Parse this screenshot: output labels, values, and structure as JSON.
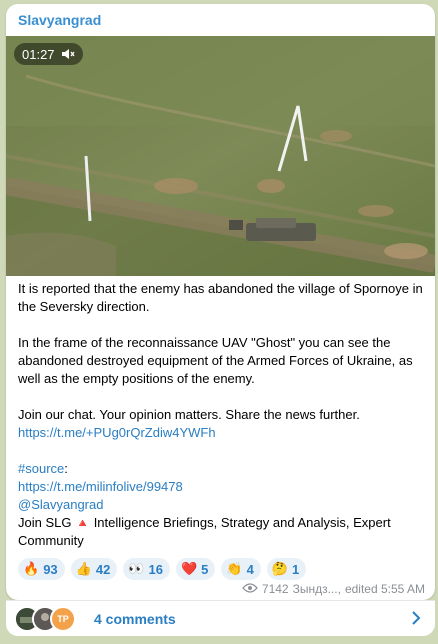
{
  "post": {
    "channel_name": "Slavyangrad",
    "video": {
      "duration": "01:27",
      "muted_icon": "speaker-muted-icon"
    },
    "paragraph1": "It is reported that the enemy has abandoned the village of Spornoye in the Seversky direction.",
    "paragraph2": "In the frame of the reconnaissance UAV \"Ghost\" you can see the abandoned destroyed equipment of the Armed Forces of Ukraine, as well as the empty positions of the enemy.",
    "paragraph3": "Join our chat. Your opinion matters. Share the news further.",
    "chat_link": "https://t.me/+PUg0rQrZdiw4YWFh",
    "hashtag": "#source",
    "hashtag_colon": ":",
    "source_link": "https://t.me/milinfolive/99478",
    "mention": "@Slavyangrad",
    "join_prefix": "Join SLG",
    "join_flag": "🔺",
    "join_suffix": "Intelligence Briefings, Strategy and Analysis, Expert Community"
  },
  "reactions": [
    {
      "emoji": "🔥",
      "icon": "fire-icon",
      "count": "93"
    },
    {
      "emoji": "👍",
      "icon": "thumbs-up-icon",
      "count": "42"
    },
    {
      "emoji": "👀",
      "icon": "eyes-icon",
      "count": "16"
    },
    {
      "emoji": "❤️",
      "icon": "heart-icon",
      "count": "5"
    },
    {
      "emoji": "👏",
      "icon": "clap-icon",
      "count": "4"
    },
    {
      "emoji": "🤔",
      "icon": "thinking-icon",
      "count": "1"
    }
  ],
  "meta": {
    "views": "7142",
    "author": "Зындз...,",
    "edited": "edited 5:55 AM"
  },
  "comments": {
    "label": "4 comments",
    "avatar_initials": "TP"
  },
  "colors": {
    "accent": "#2a7ec3",
    "channel": "#3a8fd1",
    "chip_bg": "#e9f1f8"
  }
}
